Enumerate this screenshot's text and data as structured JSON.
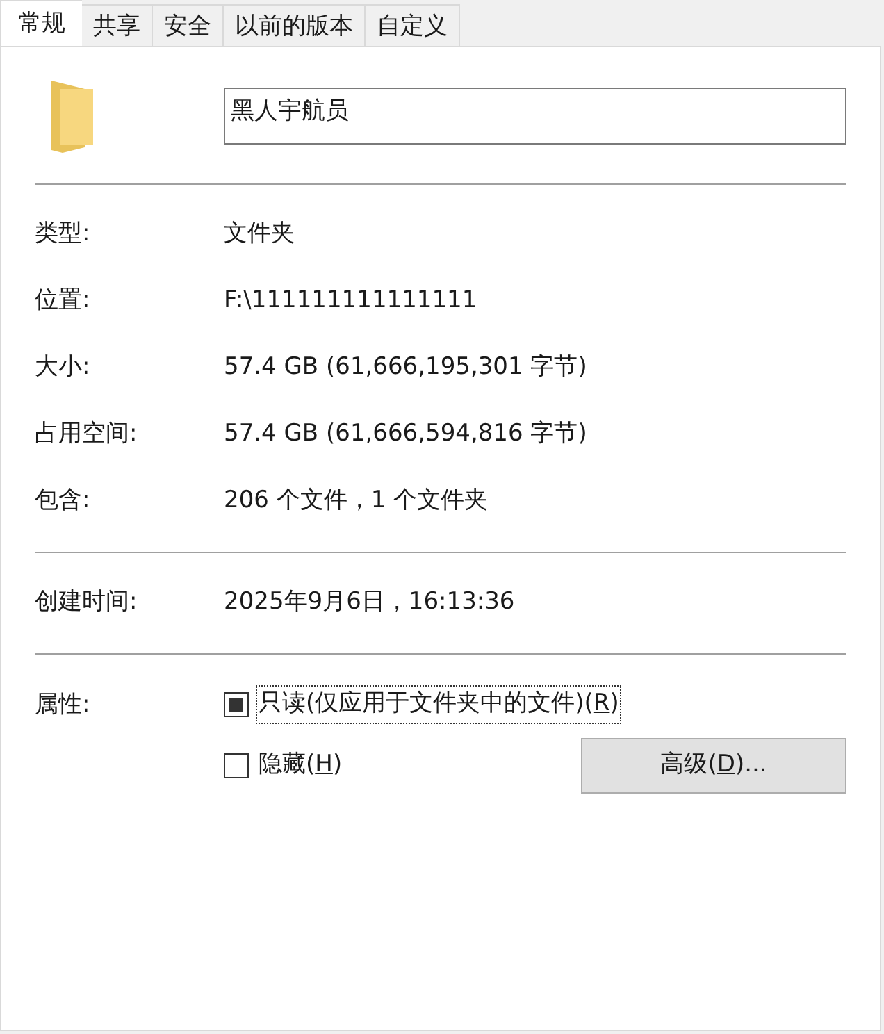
{
  "tabs": [
    {
      "label": "常规",
      "selected": true
    },
    {
      "label": "共享",
      "selected": false
    },
    {
      "label": "安全",
      "selected": false
    },
    {
      "label": "以前的版本",
      "selected": false
    },
    {
      "label": "自定义",
      "selected": false
    }
  ],
  "name_field": {
    "value": "黑人宇航员"
  },
  "groups": [
    [
      {
        "label": "类型:",
        "value": "文件夹"
      },
      {
        "label": "位置:",
        "value": "F:\\111111111111111"
      },
      {
        "label": "大小:",
        "value": "57.4 GB (61,666,195,301 字节)"
      },
      {
        "label": "占用空间:",
        "value": "57.4 GB (61,666,594,816 字节)"
      },
      {
        "label": "包含:",
        "value": "206 个文件，1 个文件夹"
      }
    ],
    [
      {
        "label": "创建时间:",
        "value": "2025年9月6日，16:13:36"
      }
    ]
  ],
  "attributes": {
    "label": "属性:",
    "checkboxes": [
      {
        "label_before": "只读(仅应用于文件夹中的文件)(",
        "hotkey": "R",
        "label_after": ")",
        "checked": false,
        "indeterminate": true,
        "focused": true
      },
      {
        "label_before": "隐藏(",
        "hotkey": "H",
        "label_after": ")",
        "checked": false,
        "indeterminate": false,
        "focused": false
      }
    ],
    "button": {
      "label_before": "高级(",
      "hotkey": "D",
      "label_after": ")..."
    }
  }
}
